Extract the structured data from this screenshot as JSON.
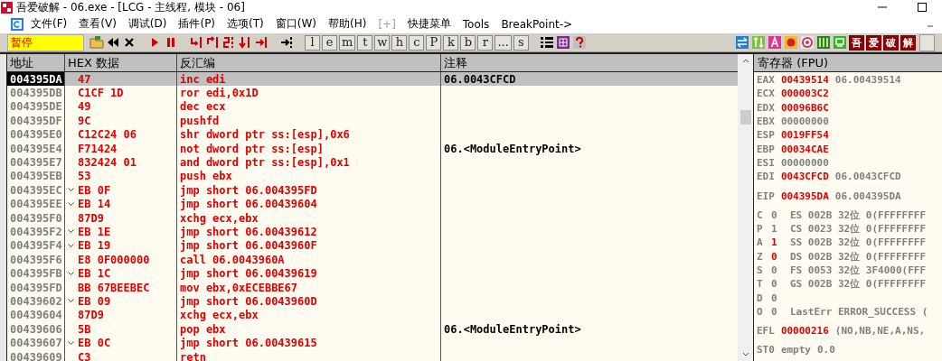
{
  "window": {
    "title": "吾爱破解 - 06.exe - [LCG - 主线程, 模块 - 06]"
  },
  "menu": [
    {
      "label": "文件(F)",
      "disabled": false
    },
    {
      "label": "查看(V)",
      "disabled": false
    },
    {
      "label": "调试(D)",
      "disabled": false
    },
    {
      "label": "插件(P)",
      "disabled": false
    },
    {
      "label": "选项(T)",
      "disabled": false
    },
    {
      "label": "窗口(W)",
      "disabled": false
    },
    {
      "label": "帮助(H)",
      "disabled": false
    },
    {
      "label": "[+]",
      "disabled": true
    },
    {
      "label": "快捷菜单",
      "disabled": false
    },
    {
      "label": "Tools",
      "disabled": false
    },
    {
      "label": "BreakPoint->",
      "disabled": false
    }
  ],
  "toolbar": {
    "status": "暂停",
    "letters": [
      "l",
      "e",
      "m",
      "t",
      "w",
      "h",
      "c",
      "P",
      "k",
      "b",
      "r",
      "...",
      "s"
    ],
    "plugin_buttons": [
      "吾",
      "爱",
      "破",
      "解"
    ]
  },
  "disassembly": {
    "columns": [
      "地址",
      "HEX 数据",
      "反汇编",
      "注释"
    ],
    "rows": [
      {
        "address": "004395DA",
        "jump": false,
        "hex": "47",
        "code": "inc edi",
        "comment": "06.0043CFCD",
        "selected": true
      },
      {
        "address": "004395DB",
        "jump": false,
        "hex": "C1CF 1D",
        "code": "ror edi,0x1D",
        "selected": false
      },
      {
        "address": "004395DE",
        "jump": false,
        "hex": "49",
        "code": "dec ecx",
        "selected": false
      },
      {
        "address": "004395DF",
        "jump": false,
        "hex": "9C",
        "code": "pushfd",
        "selected": false
      },
      {
        "address": "004395E0",
        "jump": false,
        "hex": "C12C24 06",
        "code": "shr dword ptr ss:[esp],0x6",
        "selected": false
      },
      {
        "address": "004395E4",
        "jump": false,
        "hex": "F71424",
        "code": "not dword ptr ss:[esp]",
        "comment": "06.<ModuleEntryPoint>",
        "selected": false
      },
      {
        "address": "004395E7",
        "jump": false,
        "hex": "832424 01",
        "code": "and dword ptr ss:[esp],0x1",
        "selected": false
      },
      {
        "address": "004395EB",
        "jump": false,
        "hex": "53",
        "code": "push ebx",
        "selected": false
      },
      {
        "address": "004395EC",
        "jump": true,
        "hex": "EB 0F",
        "code": "jmp short 06.004395FD",
        "selected": false
      },
      {
        "address": "004395EE",
        "jump": true,
        "hex": "EB 14",
        "code": "jmp short 06.00439604",
        "selected": false
      },
      {
        "address": "004395F0",
        "jump": false,
        "hex": "87D9",
        "code": "xchg ecx,ebx",
        "selected": false
      },
      {
        "address": "004395F2",
        "jump": true,
        "hex": "EB 1E",
        "code": "jmp short 06.00439612",
        "selected": false
      },
      {
        "address": "004395F4",
        "jump": true,
        "hex": "EB 19",
        "code": "jmp short 06.0043960F",
        "selected": false
      },
      {
        "address": "004395F6",
        "jump": false,
        "hex": "E8 0F000000",
        "code": "call 06.0043960A",
        "selected": false
      },
      {
        "address": "004395FB",
        "jump": true,
        "hex": "EB 1C",
        "code": "jmp short 06.00439619",
        "selected": false
      },
      {
        "address": "004395FD",
        "jump": false,
        "hex": "BB 67BEEBEC",
        "code": "mov ebx,0xECEBBE67",
        "selected": false
      },
      {
        "address": "00439602",
        "jump": true,
        "hex": "EB 09",
        "code": "jmp short 06.0043960D",
        "selected": false
      },
      {
        "address": "00439604",
        "jump": false,
        "hex": "87D9",
        "code": "xchg ecx,ebx",
        "selected": false
      },
      {
        "address": "00439606",
        "jump": false,
        "hex": "5B",
        "code": "pop ebx",
        "comment": "06.<ModuleEntryPoint>",
        "selected": false
      },
      {
        "address": "00439607",
        "jump": true,
        "hex": "EB 0C",
        "code": "jmp short 06.00439615",
        "selected": false
      },
      {
        "address": "00439609",
        "jump": false,
        "hex": "C3",
        "code": "retn",
        "selected": false
      }
    ]
  },
  "registers": {
    "title": "寄存器 (FPU)",
    "groups": [
      [
        {
          "kind": "reg",
          "name": "EAX",
          "value": "00439514",
          "changed": true,
          "note": "06.00439514"
        },
        {
          "kind": "reg",
          "name": "ECX",
          "value": "000003C2",
          "changed": true
        },
        {
          "kind": "reg",
          "name": "EDX",
          "value": "00096B6C",
          "changed": true
        },
        {
          "kind": "reg",
          "name": "EBX",
          "value": "00000000",
          "changed": false
        },
        {
          "kind": "reg",
          "name": "ESP",
          "value": "0019FF54",
          "changed": true
        },
        {
          "kind": "reg",
          "name": "EBP",
          "value": "00034CAE",
          "changed": true
        },
        {
          "kind": "reg",
          "name": "ESI",
          "value": "00000000",
          "changed": false
        },
        {
          "kind": "reg",
          "name": "EDI",
          "value": "0043CFCD",
          "changed": true,
          "note": "06.0043CFCD"
        }
      ],
      [
        {
          "kind": "reg",
          "name": "EIP",
          "value": "004395DA",
          "changed": true,
          "note": "06.004395DA"
        }
      ],
      [
        {
          "kind": "flag",
          "name": "C",
          "value": "0",
          "changed": false,
          "note": "ES 002B 32位 0(FFFFFFFF"
        },
        {
          "kind": "flag",
          "name": "P",
          "value": "1",
          "changed": false,
          "note": "CS 0023 32位 0(FFFFFFFF"
        },
        {
          "kind": "flag",
          "name": "A",
          "value": "1",
          "changed": true,
          "note": "SS 002B 32位 0(FFFFFFFF"
        },
        {
          "kind": "flag",
          "name": "Z",
          "value": "0",
          "changed": true,
          "note": "DS 002B 32位 0(FFFFFFFF"
        },
        {
          "kind": "flag",
          "name": "S",
          "value": "0",
          "changed": false,
          "note": "FS 0053 32位 3F4000(FFF"
        },
        {
          "kind": "flag",
          "name": "T",
          "value": "0",
          "changed": false,
          "note": "GS 002B 32位 0(FFFFFFFF"
        },
        {
          "kind": "flag",
          "name": "D",
          "value": "0",
          "changed": false
        },
        {
          "kind": "flag",
          "name": "O",
          "value": "0",
          "changed": false,
          "note": "LastErr ERROR_SUCCESS ("
        }
      ],
      [
        {
          "kind": "reg",
          "name": "EFL",
          "value": "00000216",
          "changed": true,
          "note": "(NO,NB,NE,A,NS,"
        }
      ],
      [
        {
          "kind": "reg",
          "name": "ST0",
          "value": "empty",
          "changed": false,
          "note": "0.0"
        }
      ]
    ]
  }
}
